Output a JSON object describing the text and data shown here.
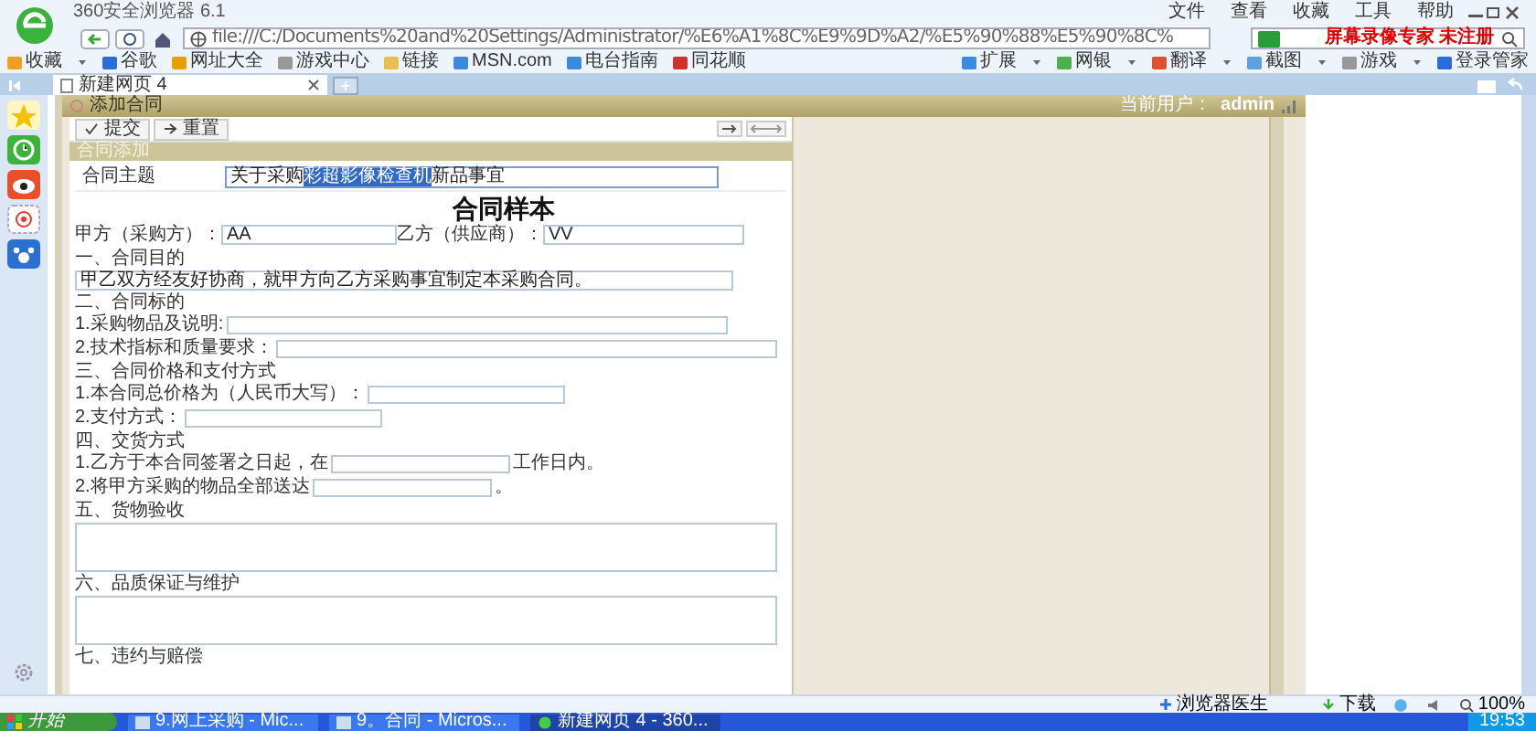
{
  "browser": {
    "title": "360安全浏览器 6.1",
    "menu": [
      "文件",
      "查看",
      "收藏",
      "工具",
      "帮助"
    ],
    "address": "file:///C:/Documents%20and%20Settings/Administrator/%E6%A1%8C%E9%9D%A2/%E5%90%88%E5%90%8C%",
    "search_value": "屏幕录像专家 未注册"
  },
  "bookmarks": [
    "收藏",
    "谷歌",
    "网址大全",
    "游戏中心",
    "链接",
    "MSN.com",
    "电台指南",
    "同花顺"
  ],
  "tools": [
    "扩展",
    "网银",
    "翻译",
    "截图",
    "游戏",
    "登录管家"
  ],
  "tabs": [
    {
      "label": "新建网页 4",
      "selected": true
    }
  ],
  "page": {
    "title": "添加合同",
    "user_label": "当前用户：",
    "user": "admin",
    "buttons": [
      "提交",
      "重置"
    ],
    "section": "合同添加"
  },
  "form": {
    "subject": {
      "label": "合同主题",
      "before": "关于采购",
      "selected": "彩超影像检查机",
      "after": "新品事宜"
    },
    "heading": "合同样本",
    "parties": [
      {
        "label": "甲方（采购方）：",
        "value": "AA"
      },
      {
        "label": "乙方（供应商）：",
        "value": "VV"
      }
    ],
    "sections": [
      {
        "title": "一、合同目的",
        "rows": [
          {
            "kind": "field",
            "value": "甲乙双方经友好协商，就甲方向乙方采购事宜制定本采购合同。"
          }
        ]
      },
      {
        "title": "二、合同标的",
        "rows": [
          {
            "kind": "labeled",
            "label": "1.采购物品及说明:"
          },
          {
            "kind": "labeled",
            "label": "2.技术指标和质量要求："
          }
        ]
      },
      {
        "title": "三、合同价格和支付方式",
        "rows": [
          {
            "kind": "labeled",
            "label": "1.本合同总价格为（人民币大写）："
          },
          {
            "kind": "labeled",
            "label": "2.支付方式："
          }
        ]
      },
      {
        "title": "四、交货方式",
        "rows": [
          {
            "kind": "labeled",
            "label": "1.乙方于本合同签署之日起，在",
            "suffix": "工作日内。"
          },
          {
            "kind": "labeled",
            "label": "2.将甲方采购的物品全部送达",
            "suffix": "。"
          }
        ]
      },
      {
        "title": "五、货物验收",
        "rows": [
          {
            "kind": "textarea"
          }
        ]
      },
      {
        "title": "六、品质保证与维护",
        "rows": [
          {
            "kind": "textarea"
          }
        ]
      },
      {
        "title": "七、违约与赔偿"
      }
    ]
  },
  "status_bar": {
    "doctor": "浏览器医生",
    "download": "下载",
    "zoom": "100%"
  },
  "taskbar": {
    "start": "开始",
    "items": [
      {
        "label": "9.网上采购 - Mic...",
        "selected": false
      },
      {
        "label": "9。合同 - Micros...",
        "selected": false
      },
      {
        "label": "新建网页 4 - 360...",
        "selected": true
      }
    ],
    "time": "19:53"
  }
}
